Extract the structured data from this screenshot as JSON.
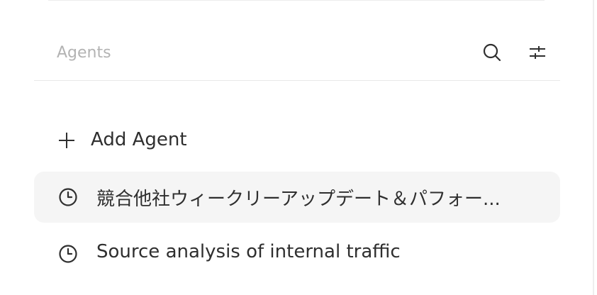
{
  "header": {
    "title": "Agents",
    "search_icon": "search-icon",
    "filter_icon": "sliders-icon"
  },
  "add_agent": {
    "label": "Add Agent",
    "icon": "plus-icon"
  },
  "agents": [
    {
      "name": "競合他社ウィークリーアップデート＆パフォー...",
      "icon": "clock-icon",
      "selected": true
    },
    {
      "name": "Source analysis of internal traffic",
      "icon": "clock-icon",
      "selected": false
    }
  ],
  "colors": {
    "background": "#ffffff",
    "selected_row": "#f5f5f5",
    "header_text": "#b3b3b3",
    "text": "#2f2f2f",
    "divider": "#e8e8e8"
  }
}
